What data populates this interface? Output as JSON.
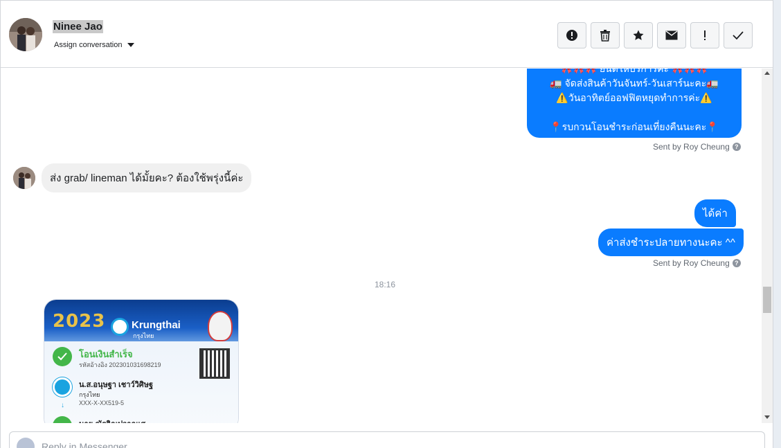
{
  "header": {
    "contact_name": "Ninee Jao",
    "assign_label": "Assign conversation",
    "actions": [
      {
        "name": "mark-spam",
        "icon": "alert-circle-icon"
      },
      {
        "name": "delete",
        "icon": "trash-icon"
      },
      {
        "name": "star",
        "icon": "star-icon"
      },
      {
        "name": "mark-unread",
        "icon": "envelope-icon"
      },
      {
        "name": "follow-up",
        "icon": "exclamation-icon"
      },
      {
        "name": "mark-done",
        "icon": "check-icon"
      }
    ]
  },
  "thread": {
    "promo_lines": [
      "🎀🎀🎀 ยินดีให้บริการค่ะ 🎀🎀🎀",
      "🚛 จัดส่งสินค้าวันจันทร์-วันเสาร์นะคะ🚛",
      "⚠️วันอาทิตย์ออฟฟิตหยุดทำการค่ะ⚠️",
      "",
      "📍รบกวนโอนชำระก่อนเที่ยงคืนนะคะ📍"
    ],
    "sent_by_1": "Sent by Roy Cheung",
    "incoming_message": "ส่ง grab/ lineman ได้มั้ยคะ? ต้องใช้พรุ่งนี้ค่ะ",
    "reply_1": "ได้ค่า",
    "reply_2": "ค่าส่งชำระปลายทางนะคะ ^^",
    "sent_by_2": "Sent by Roy Cheung",
    "timestamp": "18:16",
    "slip": {
      "year": "2023",
      "bank_name": "Krungthai",
      "bank_name_th": "กรุงไทย",
      "status": "โอนเงินสำเร็จ",
      "reference": "รหัสอ้างอิง 202301031698219",
      "from_name": "น.ส.อนุษฐา เชาว์วิศิษฐ",
      "from_bank": "กรุงไทย",
      "from_account": "XXX-X-XX519-5",
      "to_name": "นาย ณัฐจิณปวาณเส"
    }
  },
  "composer": {
    "placeholder": "Reply in Messenger..."
  }
}
